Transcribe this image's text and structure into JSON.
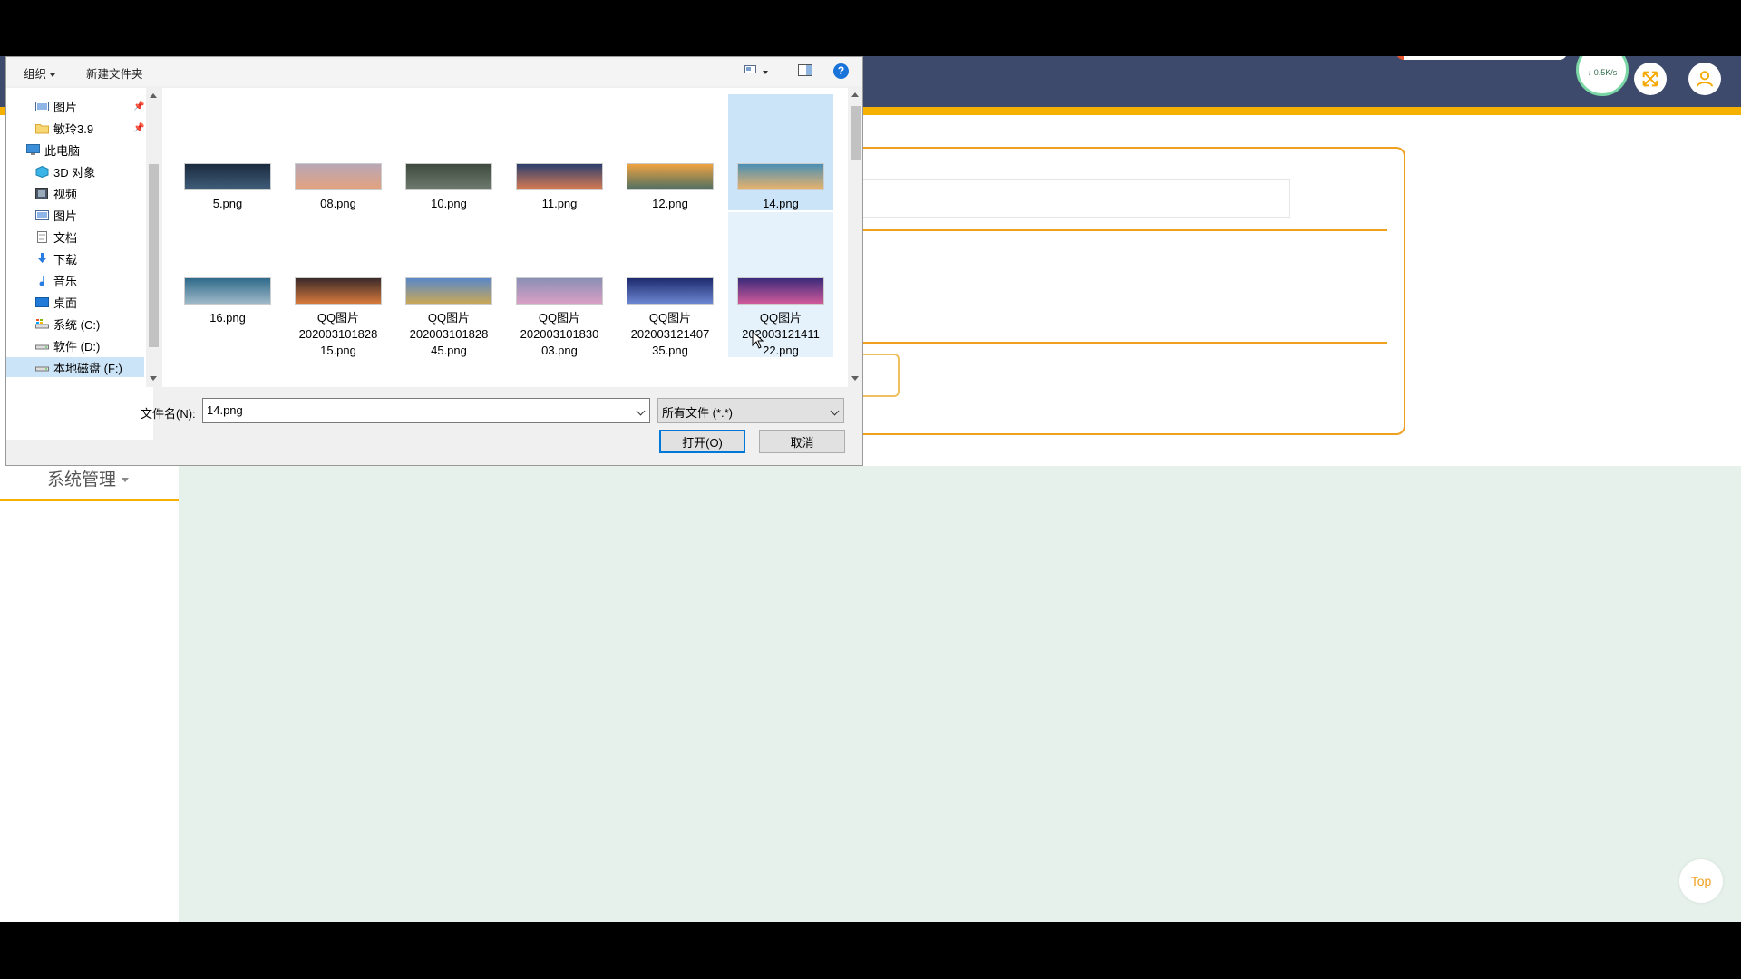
{
  "web": {
    "net_speed": "↓ 0.5K/s",
    "menu_system": "系统管理",
    "top_button": "Top"
  },
  "dialog": {
    "toolbar": {
      "organize": "组织",
      "new_folder": "新建文件夹",
      "help": "?"
    },
    "nav": [
      {
        "label": "图片",
        "icon": "pictures-icon",
        "pinned": true
      },
      {
        "label": "敏玲3.9",
        "icon": "folder-icon",
        "pinned": true
      },
      {
        "label": "此电脑",
        "icon": "computer-icon"
      },
      {
        "label": "3D 对象",
        "icon": "3d-objects-icon"
      },
      {
        "label": "视频",
        "icon": "videos-icon"
      },
      {
        "label": "图片",
        "icon": "pictures-icon"
      },
      {
        "label": "文档",
        "icon": "documents-icon"
      },
      {
        "label": "下载",
        "icon": "download-icon"
      },
      {
        "label": "音乐",
        "icon": "music-icon"
      },
      {
        "label": "桌面",
        "icon": "desktop-icon"
      },
      {
        "label": "系统 (C:)",
        "icon": "drive-c-icon"
      },
      {
        "label": "软件 (D:)",
        "icon": "drive-icon"
      },
      {
        "label": "本地磁盘 (F:)",
        "icon": "drive-icon",
        "selected": true
      }
    ],
    "files": [
      {
        "name": "5.png",
        "colors": [
          "#1b2a3e",
          "#3f5d7a"
        ]
      },
      {
        "name": "08.png",
        "colors": [
          "#b8a7b5",
          "#e3a27e"
        ]
      },
      {
        "name": "10.png",
        "colors": [
          "#3d4a3d",
          "#6f7a6f"
        ]
      },
      {
        "name": "11.png",
        "colors": [
          "#2a3f6e",
          "#d97b53"
        ]
      },
      {
        "name": "12.png",
        "colors": [
          "#f0a340",
          "#4f6f63"
        ]
      },
      {
        "name": "14.png",
        "colors": [
          "#4a8fb5",
          "#e9b36a"
        ],
        "selected": true
      },
      {
        "name": "16.png",
        "colors": [
          "#2f6a8a",
          "#9fb9c8"
        ]
      },
      {
        "name": "QQ图片20200310182815.png",
        "lines": [
          "QQ图片",
          "202003101828",
          "15.png"
        ],
        "colors": [
          "#3a2a2a",
          "#d87a3b"
        ]
      },
      {
        "name": "QQ图片20200310182845.png",
        "lines": [
          "QQ图片",
          "202003101828",
          "45.png"
        ],
        "colors": [
          "#5a88c8",
          "#c9a857"
        ]
      },
      {
        "name": "QQ图片20200310183003.png",
        "lines": [
          "QQ图片",
          "202003101830",
          "03.png"
        ],
        "colors": [
          "#8b8fb5",
          "#d9a0c5"
        ]
      },
      {
        "name": "QQ图片20200312140735.png",
        "lines": [
          "QQ图片",
          "202003121407",
          "35.png"
        ],
        "colors": [
          "#1e2a6e",
          "#6c87d1"
        ]
      },
      {
        "name": "QQ图片20200312141122.png",
        "lines": [
          "QQ图片",
          "202003121411",
          "22.png"
        ],
        "colors": [
          "#3a2a7a",
          "#d05a9a"
        ],
        "hover": true
      }
    ],
    "filename_label": "文件名(N):",
    "filename_value": "14.png",
    "filetype_value": "所有文件 (*.*)",
    "open_button": "打开(O)",
    "cancel_button": "取消"
  },
  "colors": {
    "header": "#3e4a6b",
    "accent": "#f5b000",
    "content_bg": "#e6f1eb",
    "selection": "#cce4f7"
  }
}
